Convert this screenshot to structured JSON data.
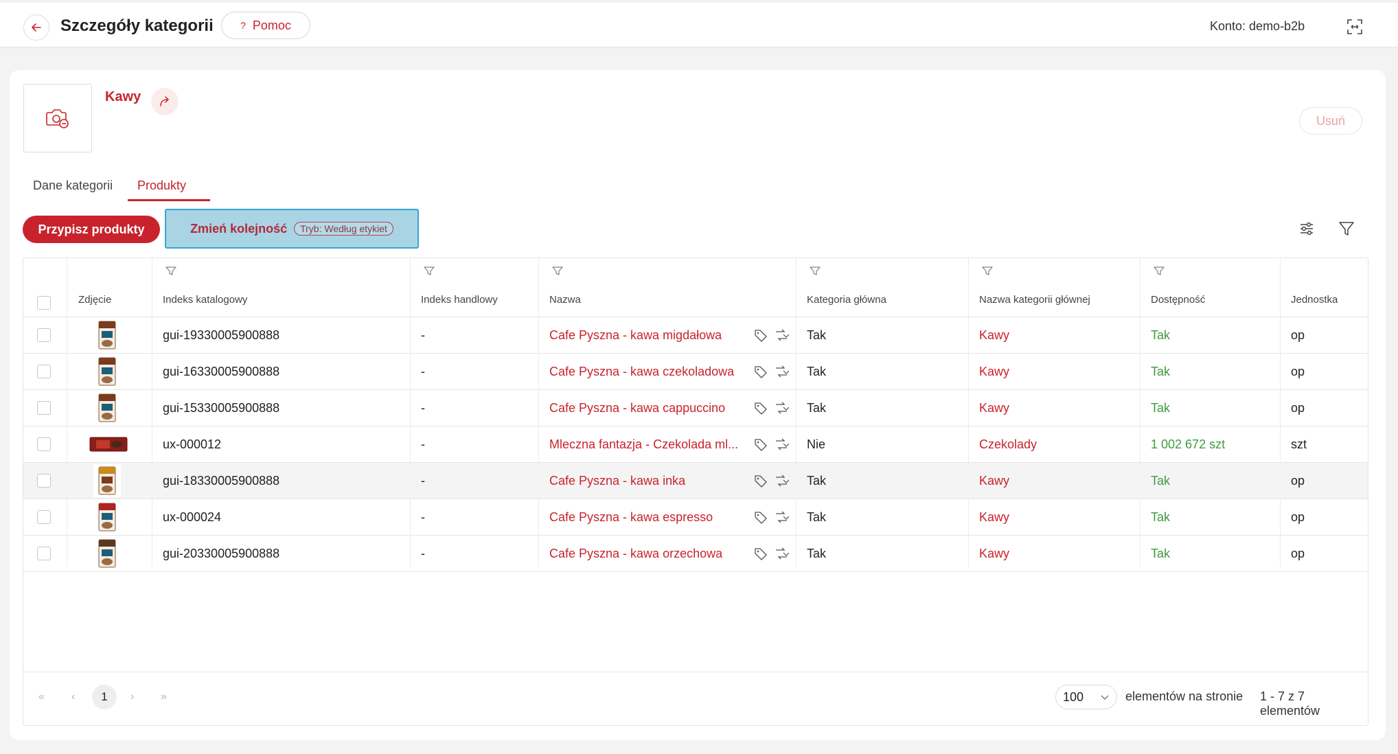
{
  "header": {
    "title": "Szczegóły kategorii",
    "help_label": "Pomoc",
    "help_glyph": "?",
    "account": "Konto: demo-b2b"
  },
  "category": {
    "name": "Kawy",
    "delete_label": "Usuń"
  },
  "tabs": [
    {
      "label": "Dane kategorii",
      "active": false
    },
    {
      "label": "Produkty",
      "active": true
    }
  ],
  "toolbar": {
    "assign_label": "Przypisz produkty",
    "reorder_label": "Zmień kolejność",
    "mode_label": "Tryb: Według etykiet"
  },
  "table": {
    "columns": [
      "Zdjęcie",
      "Indeks katalogowy",
      "Indeks handlowy",
      "Nazwa",
      "Kategoria główna",
      "Nazwa kategorii głównej",
      "Dostępność",
      "Jednostka"
    ],
    "rows": [
      {
        "catalog_index": "gui-19330005900888",
        "trade_index": "-",
        "name": "Cafe Pyszna - kawa migdałowa",
        "main_category": "Tak",
        "main_category_name": "Kawy",
        "availability": "Tak",
        "unit": "op",
        "image": "coffee-bag"
      },
      {
        "catalog_index": "gui-16330005900888",
        "trade_index": "-",
        "name": "Cafe Pyszna - kawa czekoladowa",
        "main_category": "Tak",
        "main_category_name": "Kawy",
        "availability": "Tak",
        "unit": "op",
        "image": "coffee-bag"
      },
      {
        "catalog_index": "gui-15330005900888",
        "trade_index": "-",
        "name": "Cafe Pyszna - kawa cappuccino",
        "main_category": "Tak",
        "main_category_name": "Kawy",
        "availability": "Tak",
        "unit": "op",
        "image": "coffee-bag"
      },
      {
        "catalog_index": "ux-000012",
        "trade_index": "-",
        "name": "Mleczna fantazja - Czekolada ml...",
        "main_category": "Nie",
        "main_category_name": "Czekolady",
        "availability": "1 002 672 szt",
        "unit": "szt",
        "image": "chocolate-bar"
      },
      {
        "catalog_index": "gui-18330005900888",
        "trade_index": "-",
        "name": "Cafe Pyszna - kawa inka",
        "main_category": "Tak",
        "main_category_name": "Kawy",
        "availability": "Tak",
        "unit": "op",
        "image": "coffee-bag"
      },
      {
        "catalog_index": "ux-000024",
        "trade_index": "-",
        "name": "Cafe Pyszna - kawa espresso",
        "main_category": "Tak",
        "main_category_name": "Kawy",
        "availability": "Tak",
        "unit": "op",
        "image": "coffee-bag"
      },
      {
        "catalog_index": "gui-20330005900888",
        "trade_index": "-",
        "name": "Cafe Pyszna - kawa orzechowa",
        "main_category": "Tak",
        "main_category_name": "Kawy",
        "availability": "Tak",
        "unit": "op",
        "image": "coffee-bag"
      }
    ]
  },
  "pagination": {
    "first_glyph": "«",
    "prev_glyph": "‹",
    "next_glyph": "›",
    "last_glyph": "»",
    "current_page": "1",
    "page_size": "100",
    "per_page_label": "elementów na stronie",
    "range_label": "1 - 7 z 7 elementów"
  },
  "colors": {
    "brand_red": "#c8232c",
    "available_green": "#3d9b3d",
    "focus_blue": "#36a6d4"
  }
}
